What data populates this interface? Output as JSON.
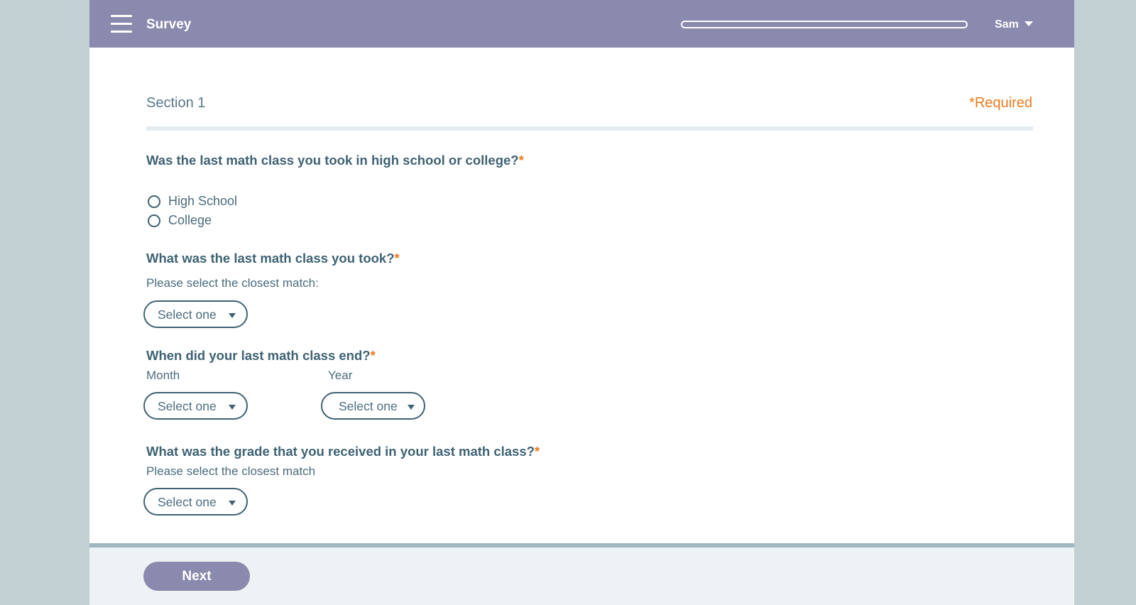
{
  "header": {
    "title": "Survey",
    "progress_fraction": 0.0,
    "user_name": "Sam"
  },
  "section": {
    "title": "Section 1",
    "required_note": "*Required"
  },
  "questions": [
    {
      "text": "Was the last math class you took in high school or college?",
      "required_mark": "*",
      "options": [
        "High School",
        "College"
      ]
    },
    {
      "text": "What was the last math class you took?",
      "required_mark": "*",
      "hint": "Please select the closest match:",
      "select_value": "Select one"
    },
    {
      "text": "When did your last math class end?",
      "required_mark": "*",
      "month_label": "Month",
      "year_label": "Year",
      "month_value": "Select one",
      "year_value": "Select one"
    },
    {
      "text": "What was the grade that you received in your last math class?",
      "required_mark": "*",
      "hint": "Please select the closest match",
      "select_value": "Select one"
    }
  ],
  "footer": {
    "next_label": "Next"
  },
  "colors": {
    "header_bg": "#8a89ae",
    "accent_orange": "#ea7a1c",
    "text_primary": "#3f6273",
    "page_bg": "#c2cfd3"
  },
  "icons": [
    "hamburger-menu-icon",
    "chevron-down-icon",
    "radio-button-icon"
  ]
}
